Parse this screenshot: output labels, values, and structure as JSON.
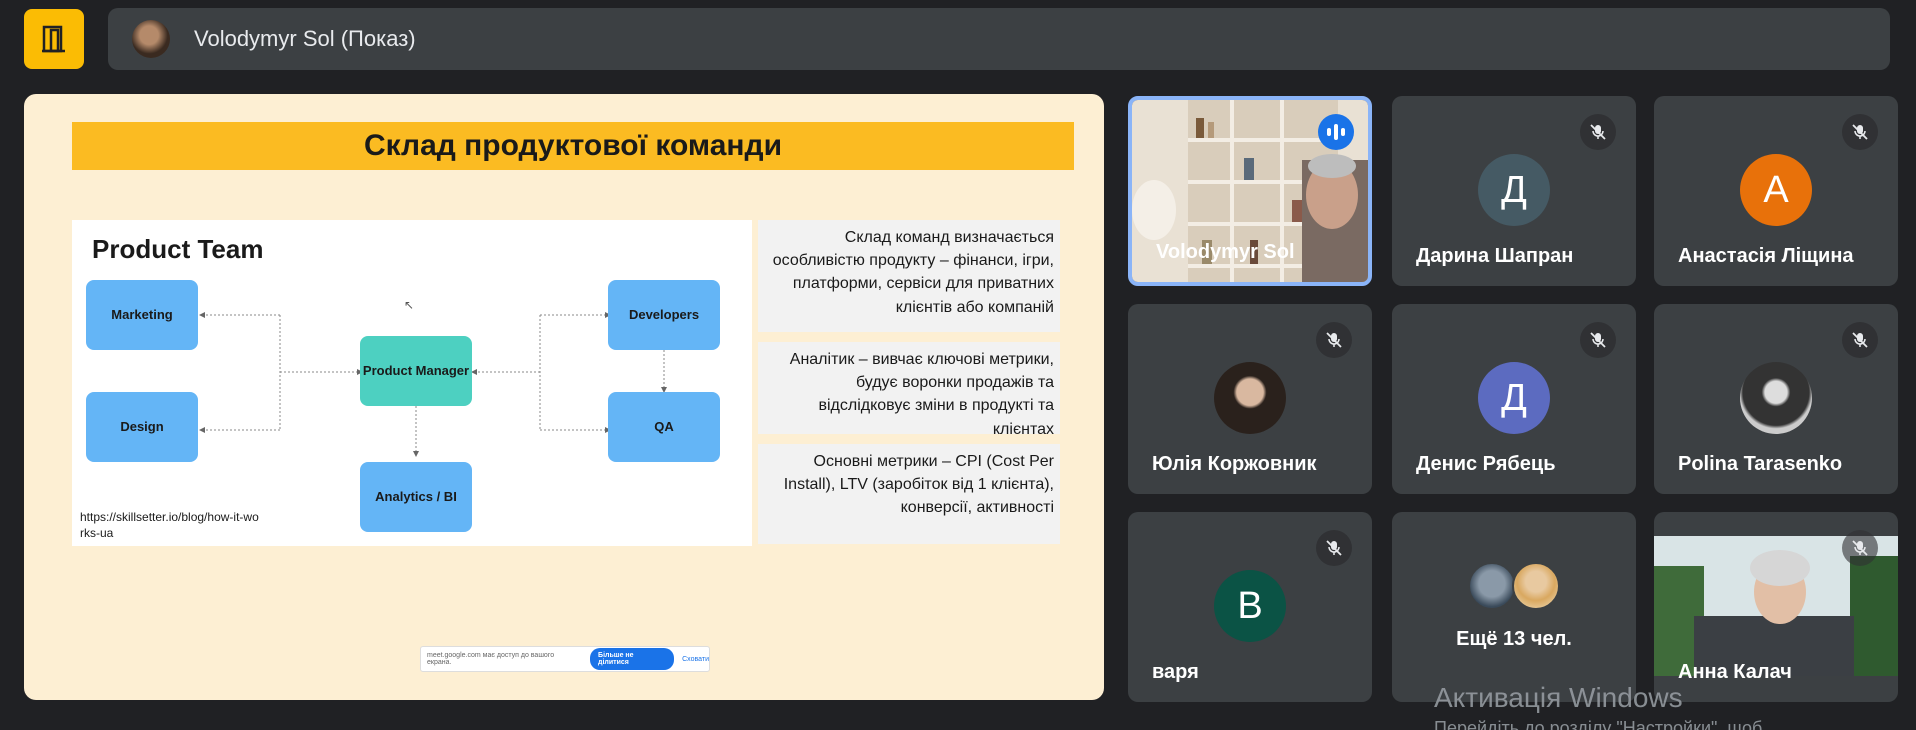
{
  "presenter": {
    "name": "Volodymyr Sol (Показ)"
  },
  "slide": {
    "title": "Склад продуктової команди",
    "diagram": {
      "title": "Product Team",
      "nodes": {
        "marketing": "Marketing",
        "design": "Design",
        "product_manager": "Product Manager",
        "analytics": "Analytics / BI",
        "developers": "Developers",
        "qa": "QA"
      },
      "source": "https://skillsetter.io/blog/how-it-works-ua"
    },
    "notes": [
      "Склад команд визначається особливістю продукту – фінанси, ігри, платформи, сервіси для приватних клієнтів або компаній",
      "Аналітик – вивчає ключові метрики, будує воронки продажів та відслідковує зміни в продукті та клієнтах",
      "Основні метрики – CPI (Cost Per Install), LTV (заробіток від 1 клієнта), конверсії, активності"
    ],
    "share_bar": {
      "text": "meet.google.com має доступ до вашого екрана.",
      "stop_label": "Більше не ділитися",
      "hide_label": "Сховати"
    }
  },
  "participants": [
    {
      "name": "Volodymyr Sol",
      "type": "video",
      "speaking": true
    },
    {
      "name": "Дарина Шапран",
      "initial": "Д",
      "color": "#455a64",
      "muted": true
    },
    {
      "name": "Анастасія Ліщина",
      "initial": "А",
      "color": "#e8710a",
      "muted": true
    },
    {
      "name": "Юлія Коржовник",
      "type": "photo",
      "muted": true
    },
    {
      "name": "Денис Рябець",
      "initial": "Д",
      "color": "#5c6bc0",
      "muted": true
    },
    {
      "name": "Polina Tarasenko",
      "type": "photo",
      "muted": true
    },
    {
      "name": "варя",
      "initial": "В",
      "color": "#0b5345",
      "muted": true
    },
    {
      "more_label": "Ещё 13 чел."
    },
    {
      "name": "Анна Калач",
      "type": "video",
      "muted": true
    }
  ],
  "watermark": {
    "title": "Активація Windows",
    "subtitle": "Перейдіть до розділу \"Настройки\", щоб"
  },
  "icons": {
    "exit": "door-exit-icon",
    "mic_off": "mic-off-icon",
    "speaking": "audio-level-icon"
  }
}
